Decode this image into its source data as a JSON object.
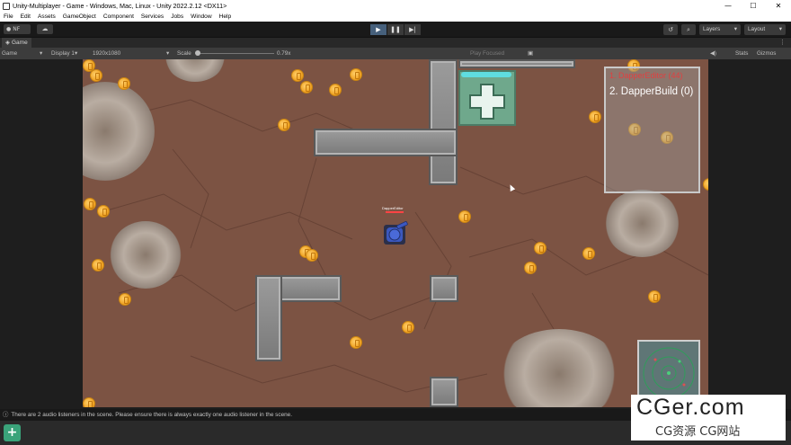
{
  "window": {
    "title": "Unity-Multiplayer - Game - Windows, Mac, Linux - Unity 2022.2.12 <DX11>",
    "controls": [
      "—",
      "☐",
      "✕"
    ]
  },
  "menu": [
    "File",
    "Edit",
    "Assets",
    "GameObject",
    "Component",
    "Services",
    "Jobs",
    "Window",
    "Help"
  ],
  "toolbar": {
    "account": "NF",
    "layers": "Layers",
    "layout": "Layout",
    "play": "▶",
    "pause": "❚❚",
    "step": "▶|"
  },
  "tab": {
    "label": "Game",
    "menu_icon": "⋮"
  },
  "game_toolbar": {
    "view": "Game",
    "display": "Display 1",
    "resolution": "1920x1080",
    "scale_label": "Scale",
    "scale_value": "0.79x",
    "play_mode": "Play Focused",
    "stats": "Stats",
    "gizmos": "Gizmos"
  },
  "scoreboard": {
    "first": "1. DapperEditor (44)",
    "second": "2. DapperBuild (0)"
  },
  "player": {
    "name": "DapperEditor",
    "color": "#3b58c0"
  },
  "status": {
    "message": "There are 2 audio listeners in the scene. Please ensure there is always exactly one audio listener in the scene."
  },
  "watermark": {
    "line1": "CGer.com",
    "line2": "CG资源 CG网站"
  },
  "colors": {
    "ground": "#7c5343",
    "coin": "#f0a222",
    "health_pad": "#6fa88c",
    "health_bar": "#5fdde0"
  }
}
